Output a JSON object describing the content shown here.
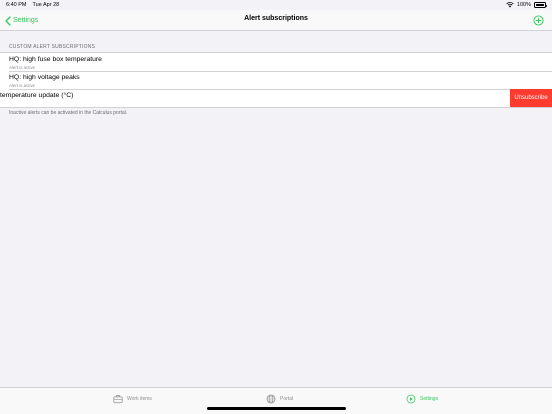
{
  "status_bar": {
    "time": "6:40 PM",
    "date": "Tue Apr 28",
    "battery": "100%"
  },
  "nav": {
    "back_label": "Settings",
    "title": "Alert subscriptions",
    "add_icon": "plus-circle-icon"
  },
  "section": {
    "header": "CUSTOM ALERT SUBSCRIPTIONS",
    "rows": [
      {
        "title": "HQ: high fuse box temperature",
        "subtitle": "Alert is active"
      },
      {
        "title": "HQ: high voltage peaks",
        "subtitle": "Alert is active"
      },
      {
        "title": "temperature update (°C)",
        "action": "Unsubscribe"
      }
    ],
    "footer": "Inactive alerts can be activated in the Calculus portal."
  },
  "tab_bar": {
    "items": [
      {
        "label": "Work items",
        "icon": "briefcase-icon"
      },
      {
        "label": "Portal",
        "icon": "globe-icon"
      },
      {
        "label": "Settings",
        "icon": "settings-play-icon",
        "active": true
      }
    ]
  },
  "colors": {
    "accent": "#34c759",
    "destructive": "#ff3b30",
    "background": "#f2f2f7"
  }
}
